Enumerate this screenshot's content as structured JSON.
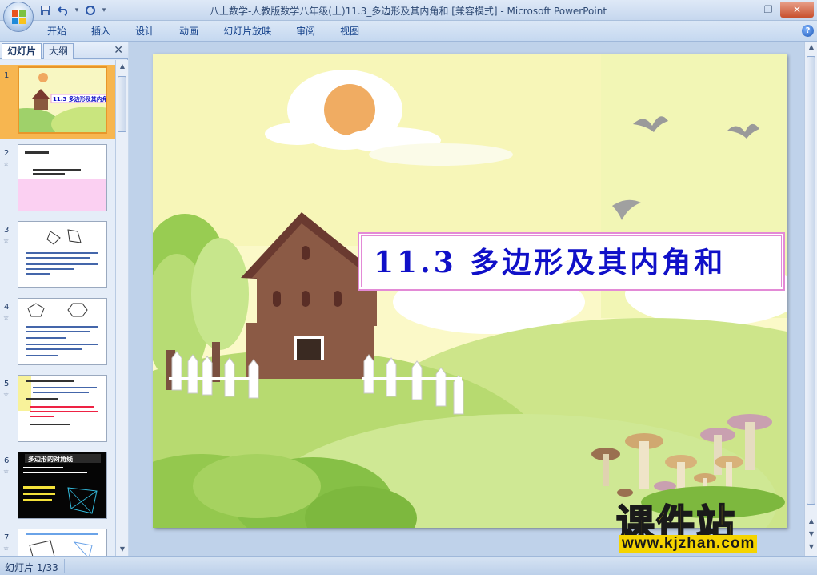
{
  "window": {
    "title": "八上数学-人教版数学八年级(上)11.3_多边形及其内角和 [兼容模式] - Microsoft PowerPoint"
  },
  "ribbon": {
    "tabs": [
      "开始",
      "插入",
      "设计",
      "动画",
      "幻灯片放映",
      "审阅",
      "视图"
    ]
  },
  "panel": {
    "tabs": [
      "幻灯片",
      "大纲"
    ],
    "slides": [
      {
        "num": "1",
        "selected": true
      },
      {
        "num": "2",
        "selected": false
      },
      {
        "num": "3",
        "selected": false
      },
      {
        "num": "4",
        "selected": false
      },
      {
        "num": "5",
        "selected": false
      },
      {
        "num": "6",
        "selected": false
      },
      {
        "num": "7",
        "selected": false
      }
    ],
    "thumb_texts": {
      "s1_title": "11.3 多边形及其内角和",
      "s6_title": "多边形的对角线"
    }
  },
  "slide": {
    "title": "11.3  多边形及其内角和"
  },
  "watermark": {
    "cn": "课件站",
    "url": "www.kjzhan.com"
  },
  "status": {
    "slide_counter": "幻灯片 1/33"
  },
  "colors": {
    "title_text": "#1010c8",
    "title_border": "#e38ad6",
    "selected_thumb": "#f7b650"
  }
}
